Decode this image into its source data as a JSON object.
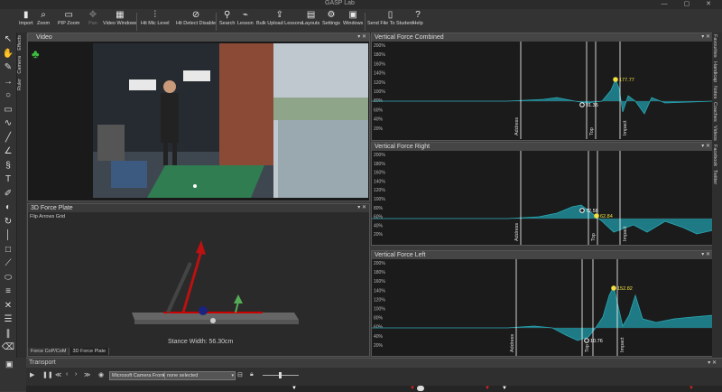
{
  "app": {
    "title": "GASP Lab"
  },
  "toolbar": {
    "items": [
      {
        "label": "Import",
        "icon": "import-icon"
      },
      {
        "label": "Zoom",
        "icon": "zoom-icon"
      },
      {
        "label": "PIP Zoom",
        "icon": "pip-zoom-icon"
      },
      {
        "label": "Pan",
        "icon": "pan-icon"
      },
      {
        "label": "Video Windows",
        "icon": "video-windows-icon"
      },
      {
        "label": "Hit Mic Level",
        "icon": "mic-level-icon"
      },
      {
        "label": "Hit Detect Disable",
        "icon": "hit-detect-icon"
      },
      {
        "label": "Search",
        "icon": "search-icon"
      },
      {
        "label": "Lesson",
        "icon": "lesson-icon"
      },
      {
        "label": "Bulk Upload Lessons",
        "icon": "bulk-upload-icon"
      },
      {
        "label": "Layouts",
        "icon": "layouts-icon"
      },
      {
        "label": "Settings",
        "icon": "settings-icon"
      },
      {
        "label": "Windows",
        "icon": "windows-icon"
      },
      {
        "label": "Send File To Student",
        "icon": "send-file-icon"
      },
      {
        "label": "Help",
        "icon": "help-icon"
      }
    ]
  },
  "left_tabs": [
    "Effects",
    "Camera",
    "Ruler"
  ],
  "right_tabs": [
    "Favourites",
    "Handicap",
    "Notes",
    "Coaches",
    "Videos",
    "Facebook",
    "Twitter"
  ],
  "video_panel": {
    "title": "Video"
  },
  "force_plate": {
    "title": "3D Force Plate",
    "options": "Flip Arrows  Grid",
    "stance_width": "Stance Width: 56.30cm",
    "tabs": [
      "Force CoP/CoM",
      "3D Force Plate"
    ]
  },
  "graphs": [
    {
      "title": "Vertical Force Combined",
      "yticks": [
        "200%",
        "180%",
        "160%",
        "140%",
        "120%",
        "100%",
        "80%",
        "60%",
        "40%",
        "20%"
      ],
      "markers": [
        "Address",
        "Top",
        "Impact"
      ],
      "labels": [
        {
          "text": "91.35",
          "color": "#ffffff"
        },
        {
          "text": "177.77",
          "color": "#f0e040"
        }
      ]
    },
    {
      "title": "Vertical Force Right",
      "yticks": [
        "200%",
        "180%",
        "160%",
        "140%",
        "120%",
        "100%",
        "80%",
        "60%",
        "40%",
        "20%"
      ],
      "markers": [
        "Address",
        "Top",
        "Impact"
      ],
      "labels": [
        {
          "text": "72.58",
          "color": "#ffffff"
        },
        {
          "text": "62.84",
          "color": "#f0e040"
        }
      ]
    },
    {
      "title": "Vertical Force Left",
      "yticks": [
        "200%",
        "180%",
        "160%",
        "140%",
        "120%",
        "100%",
        "80%",
        "60%",
        "40%",
        "20%"
      ],
      "markers": [
        "Address",
        "Top",
        "Impact"
      ],
      "labels": [
        {
          "text": "10.76",
          "color": "#ffffff"
        },
        {
          "text": "152.82",
          "color": "#f0e040"
        }
      ]
    }
  ],
  "transport": {
    "title": "Transport",
    "camera_select": "Microsoft Camera Front",
    "none_select": "none selected"
  },
  "colors": {
    "accent": "#1f8c98",
    "highlight": "#f0e040"
  }
}
